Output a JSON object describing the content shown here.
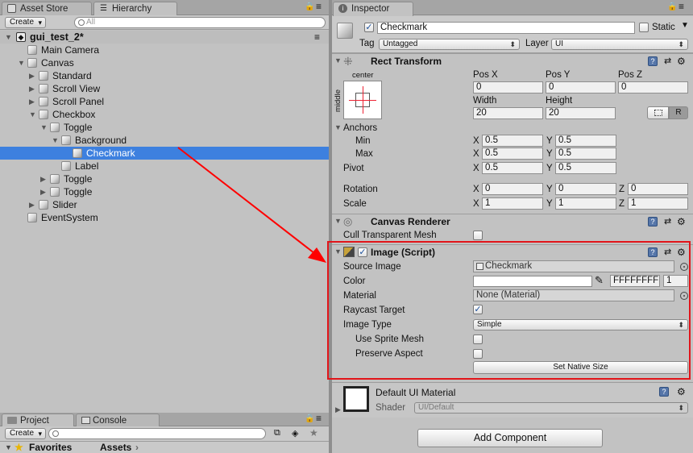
{
  "colors": {
    "selection": "#3d80df",
    "highlight_box": "#e2151a",
    "arrow": "#ff0000"
  },
  "hierarchy": {
    "tabs": [
      {
        "label": "Asset Store",
        "icon": "store-icon"
      },
      {
        "label": "Hierarchy",
        "icon": "list-icon"
      }
    ],
    "create_label": "Create",
    "search_placeholder": "All",
    "scene": {
      "label": "gui_test_2*"
    },
    "items": [
      {
        "label": "Main Camera"
      },
      {
        "label": "Canvas"
      },
      {
        "label": "Standard"
      },
      {
        "label": "Scroll View"
      },
      {
        "label": "Scroll Panel"
      },
      {
        "label": "Checkbox"
      },
      {
        "label": "Toggle"
      },
      {
        "label": "Background"
      },
      {
        "label": "Checkmark"
      },
      {
        "label": "Label"
      },
      {
        "label": "Toggle"
      },
      {
        "label": "Toggle"
      },
      {
        "label": "Slider"
      },
      {
        "label": "EventSystem"
      }
    ]
  },
  "project": {
    "tabs": [
      {
        "label": "Project"
      },
      {
        "label": "Console"
      }
    ],
    "create_label": "Create",
    "favorites_label": "Favorites",
    "assets_label": "Assets"
  },
  "inspector": {
    "tab_label": "Inspector",
    "object_name": "Checkmark",
    "static_label": "Static",
    "tag_label": "Tag",
    "tag_value": "Untagged",
    "layer_label": "Layer",
    "layer_value": "UI",
    "rect_transform": {
      "title": "Rect Transform",
      "anchor_top": "center",
      "anchor_side": "middle",
      "pos_x_label": "Pos X",
      "pos_y_label": "Pos Y",
      "pos_z_label": "Pos Z",
      "pos_x": "0",
      "pos_y": "0",
      "pos_z": "0",
      "width_label": "Width",
      "height_label": "Height",
      "width": "20",
      "height": "20",
      "r_button": "R",
      "anchors_label": "Anchors",
      "min_label": "Min",
      "max_label": "Max",
      "min_x": "0.5",
      "min_y": "0.5",
      "max_x": "0.5",
      "max_y": "0.5",
      "pivot_label": "Pivot",
      "pivot_x": "0.5",
      "pivot_y": "0.5",
      "rotation_label": "Rotation",
      "rot_x": "0",
      "rot_y": "0",
      "rot_z": "0",
      "scale_label": "Scale",
      "scale_x": "1",
      "scale_y": "1",
      "scale_z": "1",
      "x": "X",
      "y": "Y",
      "z": "Z"
    },
    "canvas_renderer": {
      "title": "Canvas Renderer",
      "cull_label": "Cull Transparent Mesh"
    },
    "image": {
      "title": "Image (Script)",
      "source_image_label": "Source Image",
      "source_image_value": "Checkmark",
      "color_label": "Color",
      "color_hex": "FFFFFFFF",
      "color_alpha": "1",
      "material_label": "Material",
      "material_value": "None (Material)",
      "raycast_label": "Raycast Target",
      "image_type_label": "Image Type",
      "image_type_value": "Simple",
      "sprite_mesh_label": "Use Sprite Mesh",
      "preserve_label": "Preserve Aspect",
      "native_size_button": "Set Native Size"
    },
    "material": {
      "title": "Default UI Material",
      "shader_label": "Shader",
      "shader_value": "UI/Default"
    },
    "add_component": "Add Component"
  }
}
